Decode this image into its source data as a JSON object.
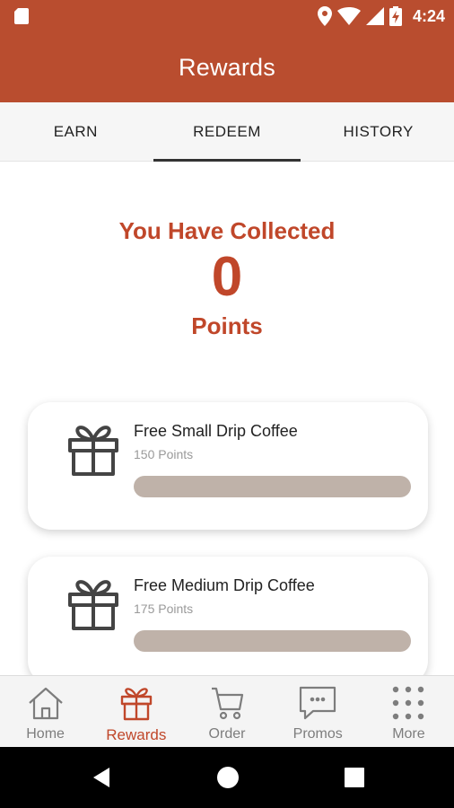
{
  "status_bar": {
    "time": "4:24"
  },
  "app_bar": {
    "title": "Rewards"
  },
  "tabs": [
    {
      "label": "EARN",
      "active": false
    },
    {
      "label": "REDEEM",
      "active": true
    },
    {
      "label": "HISTORY",
      "active": false
    }
  ],
  "points_summary": {
    "heading": "You Have Collected",
    "count": "0",
    "unit": "Points"
  },
  "rewards": [
    {
      "name": "Free Small Drip Coffee",
      "cost": "150 Points",
      "progress": 0
    },
    {
      "name": "Free Medium Drip Coffee",
      "cost": "175 Points",
      "progress": 0
    }
  ],
  "bottom_nav": [
    {
      "label": "Home",
      "icon": "home-icon",
      "active": false
    },
    {
      "label": "Rewards",
      "icon": "gift-icon",
      "active": true
    },
    {
      "label": "Order",
      "icon": "cart-icon",
      "active": false
    },
    {
      "label": "Promos",
      "icon": "chat-icon",
      "active": false
    },
    {
      "label": "More",
      "icon": "grid-dots-icon",
      "active": false
    }
  ],
  "colors": {
    "brand": "#b94d2f",
    "accent_text": "#c0472a",
    "progress_track": "#bfb2a9"
  }
}
